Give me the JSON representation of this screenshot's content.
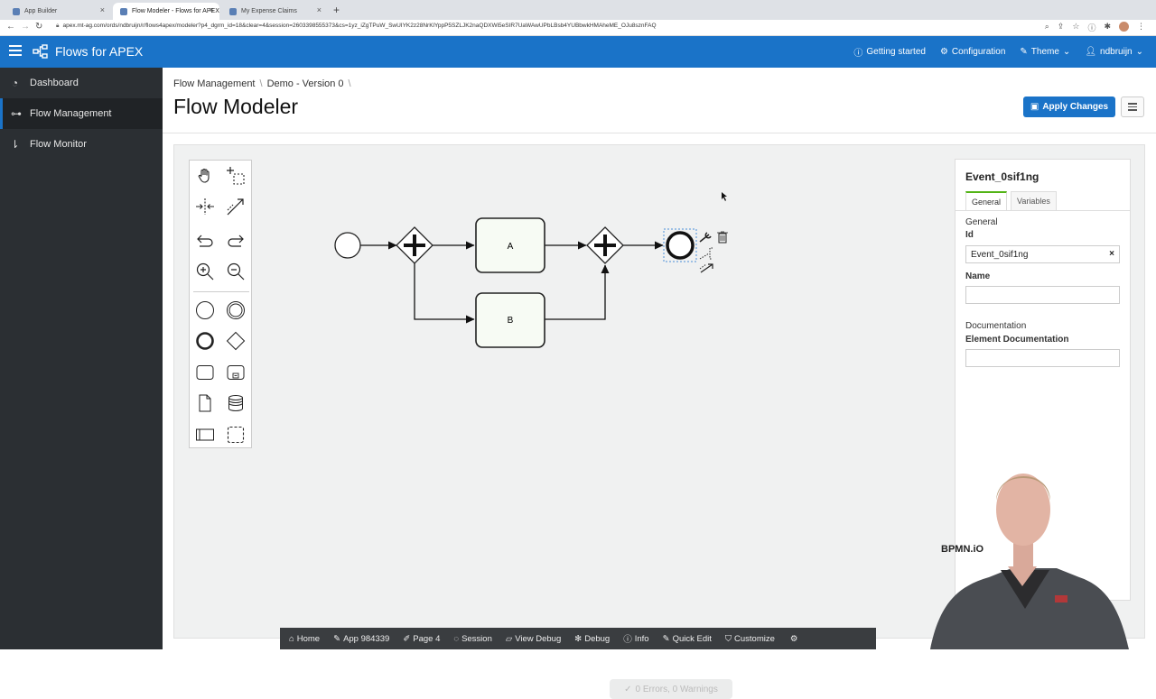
{
  "browser": {
    "tabs": [
      {
        "label": "App Builder"
      },
      {
        "label": "Flow Modeler - Flows for APEX"
      },
      {
        "label": "My Expense Claims"
      }
    ],
    "url": "apex.mt-ag.com/ords/ndbruijn/r/flows4apex/modeler?p4_dgrm_id=18&clear=4&session=2603398555373&cs=1yz_iZgTPuW_SwUIYK2z28NrKlYppP5SZLJK2naQDXWi5eSIR7UaWAwUPbLBsb4YUBbwkHMAheME_OJu8sznFAQ"
  },
  "header": {
    "app_title": "Flows for APEX",
    "nav": [
      {
        "label": "Getting started",
        "icon": "info-icon"
      },
      {
        "label": "Configuration",
        "icon": "gear-icon"
      },
      {
        "label": "Theme",
        "icon": "brush-icon"
      },
      {
        "label": "ndbruijn",
        "icon": "user-icon"
      }
    ]
  },
  "sidebar": {
    "items": [
      {
        "label": "Dashboard",
        "icon": "dashboard-icon"
      },
      {
        "label": "Flow Management",
        "icon": "tree-icon",
        "active": true
      },
      {
        "label": "Flow Monitor",
        "icon": "sort-icon"
      }
    ]
  },
  "page": {
    "breadcrumb": [
      "Flow Management",
      "Demo - Version 0"
    ],
    "title": "Flow Modeler",
    "apply_label": "Apply Changes"
  },
  "diagram": {
    "task_a": "A",
    "task_b": "B"
  },
  "properties": {
    "title": "Event_0sif1ng",
    "tabs": [
      "General",
      "Variables"
    ],
    "section_general": "General",
    "id_label": "Id",
    "id_value": "Event_0sif1ng",
    "name_label": "Name",
    "name_value": "",
    "documentation_section": "Documentation",
    "element_doc_label": "Element Documentation",
    "element_doc_value": ""
  },
  "status": "0 Errors, 0 Warnings",
  "watermark": "BPMN.iO",
  "devbar": [
    {
      "label": "Home",
      "icon": "home-icon"
    },
    {
      "label": "App 984339",
      "icon": "edit-icon"
    },
    {
      "label": "Page 4",
      "icon": "page-icon"
    },
    {
      "label": "Session",
      "icon": "session-icon"
    },
    {
      "label": "View Debug",
      "icon": "view-debug-icon"
    },
    {
      "label": "Debug",
      "icon": "bug-icon"
    },
    {
      "label": "Info",
      "icon": "info-icon"
    },
    {
      "label": "Quick Edit",
      "icon": "quick-edit-icon"
    },
    {
      "label": "Customize",
      "icon": "paint-icon"
    }
  ],
  "colors": {
    "brand": "#1a73c8",
    "sidebar": "#2b2f33",
    "task_fill": "#f7fbf4"
  }
}
